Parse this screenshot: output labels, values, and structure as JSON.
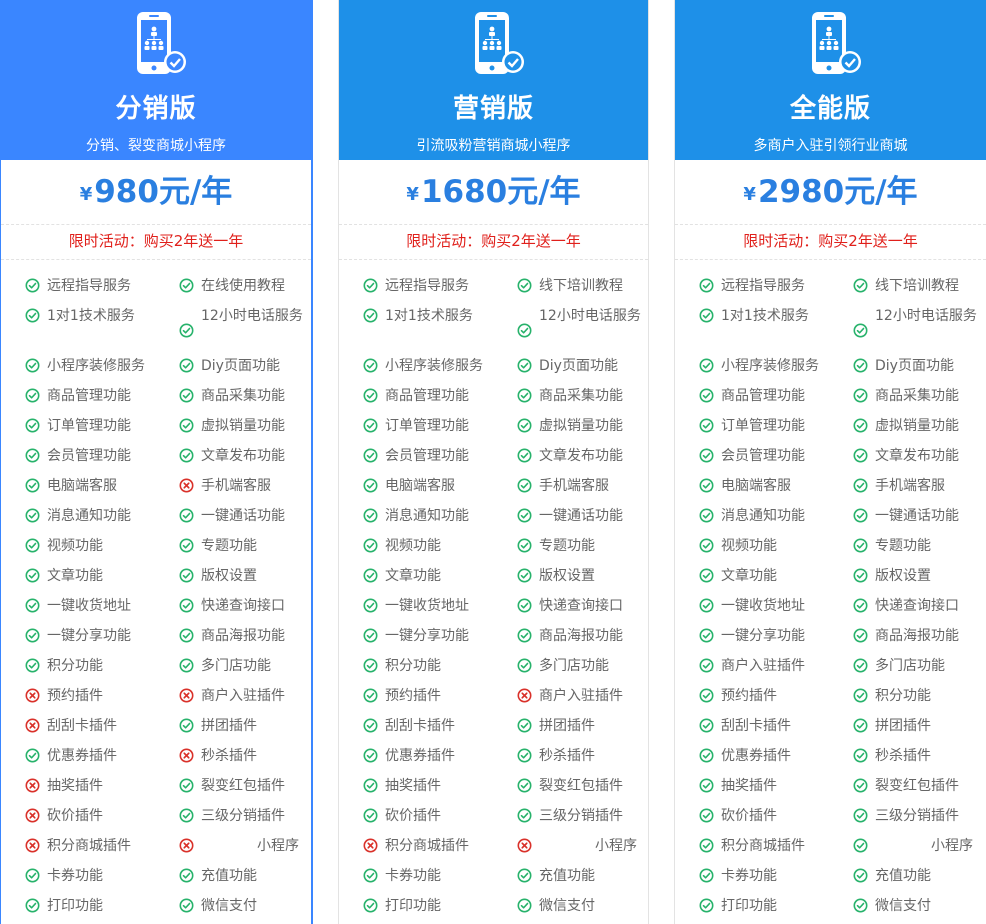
{
  "promo_text": "限时活动：购买2年送一年",
  "currency_symbol": "¥",
  "colors": {
    "header_selected": "#3a86ff",
    "header": "#1e90e8",
    "price": "#2a7fe0",
    "promo": "#e0201b",
    "check": "#27b26b",
    "cross": "#d9312a"
  },
  "icons": {
    "yes": "check-circle-icon",
    "no": "x-circle-icon",
    "header": "phone-network-icon"
  },
  "plans": [
    {
      "name": "分销版",
      "desc": "分销、裂变商城小程序",
      "price": "980元/年",
      "rows": [
        [
          {
            "t": "远程指导服务",
            "y": true
          },
          {
            "t": "在线使用教程",
            "y": true
          }
        ],
        [
          {
            "t": "1对1技术服务",
            "y": true
          },
          {
            "t": "12小时电话服务",
            "y": true
          }
        ],
        [
          {
            "t": "小程序装修服务",
            "y": true
          },
          {
            "t": "Diy页面功能",
            "y": true
          }
        ],
        [
          {
            "t": "商品管理功能",
            "y": true
          },
          {
            "t": "商品采集功能",
            "y": true
          }
        ],
        [
          {
            "t": "订单管理功能",
            "y": true
          },
          {
            "t": "虚拟销量功能",
            "y": true
          }
        ],
        [
          {
            "t": "会员管理功能",
            "y": true
          },
          {
            "t": "文章发布功能",
            "y": true
          }
        ],
        [
          {
            "t": "电脑端客服",
            "y": true
          },
          {
            "t": "手机端客服",
            "y": false
          }
        ],
        [
          {
            "t": "消息通知功能",
            "y": true
          },
          {
            "t": "一键通话功能",
            "y": true
          }
        ],
        [
          {
            "t": "视频功能",
            "y": true
          },
          {
            "t": "专题功能",
            "y": true
          }
        ],
        [
          {
            "t": "文章功能",
            "y": true
          },
          {
            "t": "版权设置",
            "y": true
          }
        ],
        [
          {
            "t": "一键收货地址",
            "y": true
          },
          {
            "t": "快递查询接口",
            "y": true
          }
        ],
        [
          {
            "t": "一键分享功能",
            "y": true
          },
          {
            "t": "商品海报功能",
            "y": true
          }
        ],
        [
          {
            "t": "积分功能",
            "y": true
          },
          {
            "t": "多门店功能",
            "y": true
          }
        ],
        [
          {
            "t": "预约插件",
            "y": false
          },
          {
            "t": "商户入驻插件",
            "y": false
          }
        ],
        [
          {
            "t": "刮刮卡插件",
            "y": false
          },
          {
            "t": "拼团插件",
            "y": true
          }
        ],
        [
          {
            "t": "优惠券插件",
            "y": true
          },
          {
            "t": "秒杀插件",
            "y": false
          }
        ],
        [
          {
            "t": "抽奖插件",
            "y": false
          },
          {
            "t": "裂变红包插件",
            "y": true
          }
        ],
        [
          {
            "t": "砍价插件",
            "y": false
          },
          {
            "t": "三级分销插件",
            "y": true
          }
        ],
        [
          {
            "t": "积分商城插件",
            "y": false
          },
          {
            "t": "小程序",
            "y": false
          }
        ],
        [
          {
            "t": "卡券功能",
            "y": true
          },
          {
            "t": "充值功能",
            "y": true
          }
        ],
        [
          {
            "t": "打印功能",
            "y": true
          },
          {
            "t": "微信支付",
            "y": true
          }
        ]
      ]
    },
    {
      "name": "营销版",
      "desc": "引流吸粉营销商城小程序",
      "price": "1680元/年",
      "rows": [
        [
          {
            "t": "远程指导服务",
            "y": true
          },
          {
            "t": "线下培训教程",
            "y": true
          }
        ],
        [
          {
            "t": "1对1技术服务",
            "y": true
          },
          {
            "t": "12小时电话服务",
            "y": true
          }
        ],
        [
          {
            "t": "小程序装修服务",
            "y": true
          },
          {
            "t": "Diy页面功能",
            "y": true
          }
        ],
        [
          {
            "t": "商品管理功能",
            "y": true
          },
          {
            "t": "商品采集功能",
            "y": true
          }
        ],
        [
          {
            "t": "订单管理功能",
            "y": true
          },
          {
            "t": "虚拟销量功能",
            "y": true
          }
        ],
        [
          {
            "t": "会员管理功能",
            "y": true
          },
          {
            "t": "文章发布功能",
            "y": true
          }
        ],
        [
          {
            "t": "电脑端客服",
            "y": true
          },
          {
            "t": "手机端客服",
            "y": true
          }
        ],
        [
          {
            "t": "消息通知功能",
            "y": true
          },
          {
            "t": "一键通话功能",
            "y": true
          }
        ],
        [
          {
            "t": "视频功能",
            "y": true
          },
          {
            "t": "专题功能",
            "y": true
          }
        ],
        [
          {
            "t": "文章功能",
            "y": true
          },
          {
            "t": "版权设置",
            "y": true
          }
        ],
        [
          {
            "t": "一键收货地址",
            "y": true
          },
          {
            "t": "快递查询接口",
            "y": true
          }
        ],
        [
          {
            "t": "一键分享功能",
            "y": true
          },
          {
            "t": "商品海报功能",
            "y": true
          }
        ],
        [
          {
            "t": "积分功能",
            "y": true
          },
          {
            "t": "多门店功能",
            "y": true
          }
        ],
        [
          {
            "t": "预约插件",
            "y": true
          },
          {
            "t": "商户入驻插件",
            "y": false
          }
        ],
        [
          {
            "t": "刮刮卡插件",
            "y": true
          },
          {
            "t": "拼团插件",
            "y": true
          }
        ],
        [
          {
            "t": "优惠券插件",
            "y": true
          },
          {
            "t": "秒杀插件",
            "y": true
          }
        ],
        [
          {
            "t": "抽奖插件",
            "y": true
          },
          {
            "t": "裂变红包插件",
            "y": true
          }
        ],
        [
          {
            "t": "砍价插件",
            "y": true
          },
          {
            "t": "三级分销插件",
            "y": true
          }
        ],
        [
          {
            "t": "积分商城插件",
            "y": false
          },
          {
            "t": "小程序",
            "y": false
          }
        ],
        [
          {
            "t": "卡券功能",
            "y": true
          },
          {
            "t": "充值功能",
            "y": true
          }
        ],
        [
          {
            "t": "打印功能",
            "y": true
          },
          {
            "t": "微信支付",
            "y": true
          }
        ]
      ]
    },
    {
      "name": "全能版",
      "desc": "多商户入驻引领行业商城",
      "price": "2980元/年",
      "rows": [
        [
          {
            "t": "远程指导服务",
            "y": true
          },
          {
            "t": "线下培训教程",
            "y": true
          }
        ],
        [
          {
            "t": "1对1技术服务",
            "y": true
          },
          {
            "t": "12小时电话服务",
            "y": true
          }
        ],
        [
          {
            "t": "小程序装修服务",
            "y": true
          },
          {
            "t": "Diy页面功能",
            "y": true
          }
        ],
        [
          {
            "t": "商品管理功能",
            "y": true
          },
          {
            "t": "商品采集功能",
            "y": true
          }
        ],
        [
          {
            "t": "订单管理功能",
            "y": true
          },
          {
            "t": "虚拟销量功能",
            "y": true
          }
        ],
        [
          {
            "t": "会员管理功能",
            "y": true
          },
          {
            "t": "文章发布功能",
            "y": true
          }
        ],
        [
          {
            "t": "电脑端客服",
            "y": true
          },
          {
            "t": "手机端客服",
            "y": true
          }
        ],
        [
          {
            "t": "消息通知功能",
            "y": true
          },
          {
            "t": "一键通话功能",
            "y": true
          }
        ],
        [
          {
            "t": "视频功能",
            "y": true
          },
          {
            "t": "专题功能",
            "y": true
          }
        ],
        [
          {
            "t": "文章功能",
            "y": true
          },
          {
            "t": "版权设置",
            "y": true
          }
        ],
        [
          {
            "t": "一键收货地址",
            "y": true
          },
          {
            "t": "快递查询接口",
            "y": true
          }
        ],
        [
          {
            "t": "一键分享功能",
            "y": true
          },
          {
            "t": "商品海报功能",
            "y": true
          }
        ],
        [
          {
            "t": "商户入驻插件",
            "y": true
          },
          {
            "t": "多门店功能",
            "y": true
          }
        ],
        [
          {
            "t": "预约插件",
            "y": true
          },
          {
            "t": "积分功能",
            "y": true
          }
        ],
        [
          {
            "t": "刮刮卡插件",
            "y": true
          },
          {
            "t": "拼团插件",
            "y": true
          }
        ],
        [
          {
            "t": "优惠券插件",
            "y": true
          },
          {
            "t": "秒杀插件",
            "y": true
          }
        ],
        [
          {
            "t": "抽奖插件",
            "y": true
          },
          {
            "t": "裂变红包插件",
            "y": true
          }
        ],
        [
          {
            "t": "砍价插件",
            "y": true
          },
          {
            "t": "三级分销插件",
            "y": true
          }
        ],
        [
          {
            "t": "积分商城插件",
            "y": true
          },
          {
            "t": "小程序",
            "y": true
          }
        ],
        [
          {
            "t": "卡券功能",
            "y": true
          },
          {
            "t": "充值功能",
            "y": true
          }
        ],
        [
          {
            "t": "打印功能",
            "y": true
          },
          {
            "t": "微信支付",
            "y": true
          }
        ]
      ]
    }
  ]
}
